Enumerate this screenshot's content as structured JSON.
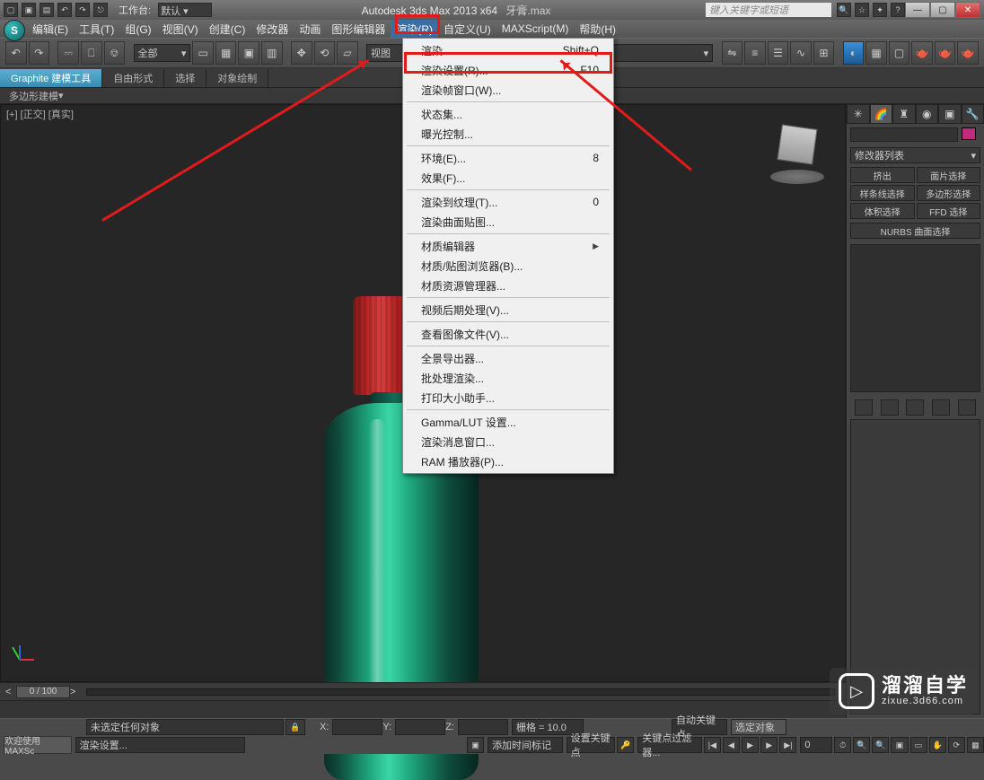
{
  "titlebar": {
    "workspace_label": "工作台:",
    "workspace_value": "默认",
    "app_title": "Autodesk 3ds Max 2013 x64",
    "file_name": "牙膏.max",
    "search_placeholder": "键入关键字或短语"
  },
  "menubar": {
    "items": [
      {
        "label": "编辑(E)"
      },
      {
        "label": "工具(T)"
      },
      {
        "label": "组(G)"
      },
      {
        "label": "视图(V)"
      },
      {
        "label": "创建(C)"
      },
      {
        "label": "修改器"
      },
      {
        "label": "动画"
      },
      {
        "label": "图形编辑器"
      },
      {
        "label": "渲染(R)",
        "highlight": true
      },
      {
        "label": "自定义(U)"
      },
      {
        "label": "MAXScript(M)"
      },
      {
        "label": "帮助(H)"
      }
    ]
  },
  "toolbar": {
    "filter_combo": "全部",
    "view_btn": "视图"
  },
  "ribbon": {
    "tabs": [
      {
        "label": "Graphite 建模工具",
        "active": true
      },
      {
        "label": "自由形式"
      },
      {
        "label": "选择"
      },
      {
        "label": "对象绘制"
      }
    ],
    "sub_label": "多边形建模"
  },
  "viewport": {
    "label": "[+] [正交] [真实]"
  },
  "dropdown": {
    "groups": [
      [
        {
          "label": "渲染",
          "shortcut": "Shift+Q"
        },
        {
          "label": "渲染设置(R)...",
          "shortcut": "F10"
        },
        {
          "label": "渲染帧窗口(W)..."
        }
      ],
      [
        {
          "label": "状态集..."
        },
        {
          "label": "曝光控制..."
        }
      ],
      [
        {
          "label": "环境(E)...",
          "shortcut": "8"
        },
        {
          "label": "效果(F)..."
        }
      ],
      [
        {
          "label": "渲染到纹理(T)...",
          "shortcut": "0"
        },
        {
          "label": "渲染曲面贴图..."
        }
      ],
      [
        {
          "label": "材质编辑器",
          "arrow": true
        },
        {
          "label": "材质/贴图浏览器(B)..."
        },
        {
          "label": "材质资源管理器..."
        }
      ],
      [
        {
          "label": "视频后期处理(V)..."
        }
      ],
      [
        {
          "label": "查看图像文件(V)..."
        }
      ],
      [
        {
          "label": "全景导出器..."
        },
        {
          "label": "批处理渲染..."
        },
        {
          "label": "打印大小助手..."
        }
      ],
      [
        {
          "label": "Gamma/LUT 设置..."
        },
        {
          "label": "渲染消息窗口..."
        },
        {
          "label": "RAM 播放器(P)..."
        }
      ]
    ]
  },
  "command_panel": {
    "modlist_label": "修改器列表",
    "sel_buttons": [
      "挤出",
      "面片选择",
      "样条线选择",
      "多边形选择",
      "体积选择",
      "FFD 选择"
    ],
    "nurbs_label": "NURBS 曲面选择"
  },
  "time_slider": {
    "frame_label": "0 / 100"
  },
  "statusbar": {
    "welcome": "欢迎使用 MAXSc",
    "no_selection": "未选定任何对象",
    "render_label": "渲染设置...",
    "x_label": "X:",
    "y_label": "Y:",
    "z_label": "Z:",
    "grid_label": "栅格 = 10.0",
    "autokey": "自动关键点",
    "setkey": "设置关键点",
    "sel_obj": "选定对象",
    "keyfilter": "关键点过滤器...",
    "add_time": "添加时间标记"
  },
  "watermark": {
    "brand": "溜溜自学",
    "url": "zixue.3d66.com"
  }
}
